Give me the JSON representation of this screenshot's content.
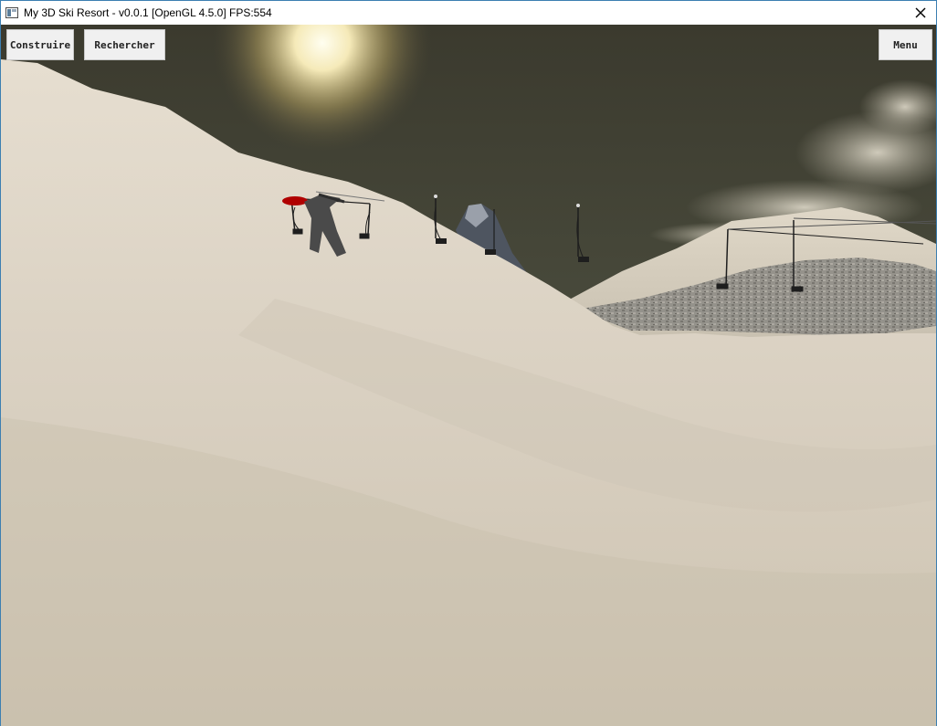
{
  "window": {
    "title": "My 3D Ski Resort - v0.0.1 [OpenGL 4.5.0] FPS:554",
    "close_glyph": "✕"
  },
  "hud": {
    "build_label": "Construire",
    "search_label": "Rechercher",
    "menu_label": "Menu"
  },
  "scene": {
    "sky_color": "#4a4a3c",
    "sun_color": "#fff6d0",
    "snow_color": "#d8cfc0",
    "rock_color": "#6f747c",
    "icons": [
      "app-icon",
      "close-icon"
    ]
  }
}
